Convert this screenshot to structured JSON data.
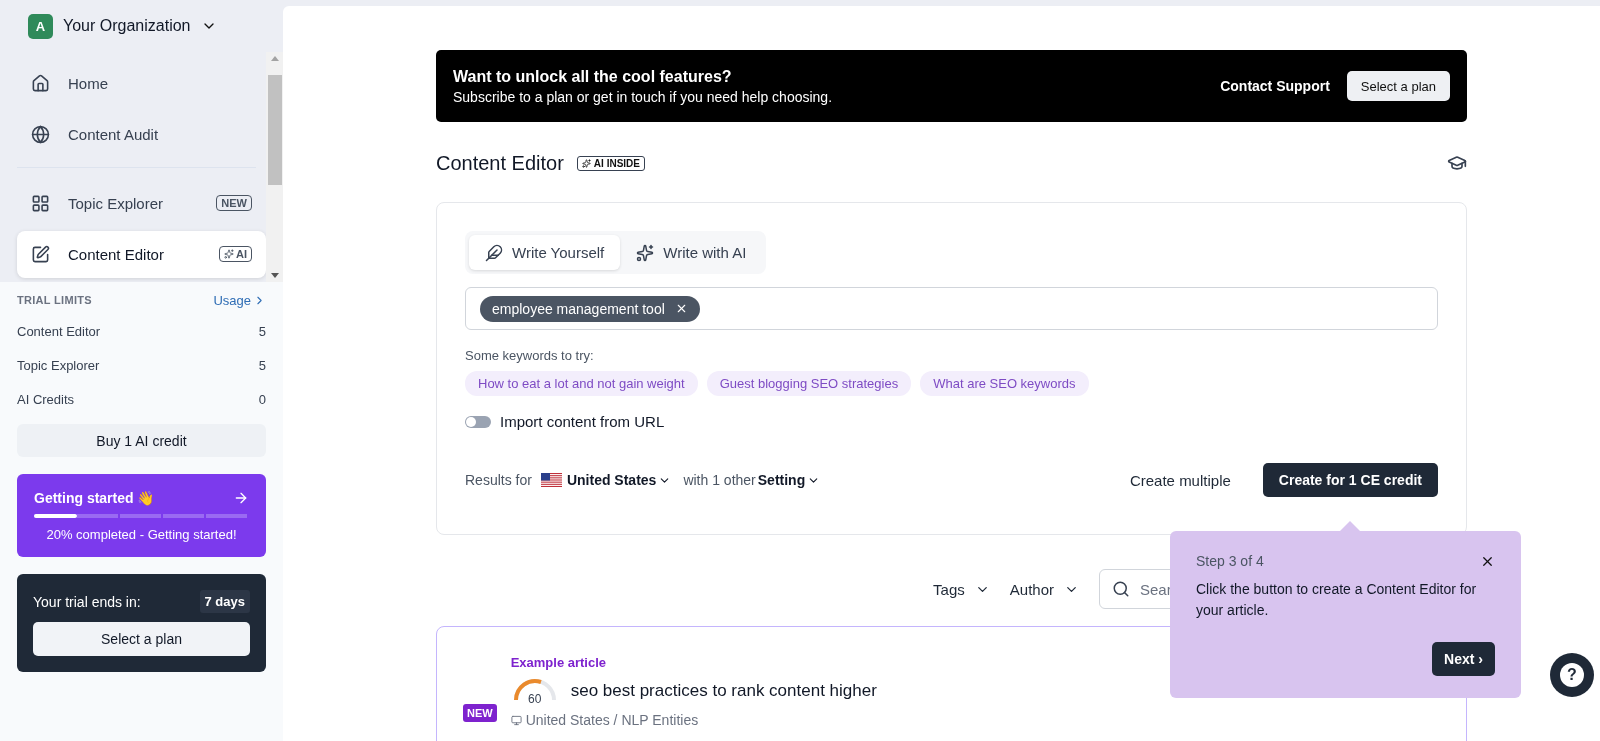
{
  "organization": {
    "initial": "A",
    "name": "Your Organization"
  },
  "sidebar": {
    "items": [
      {
        "label": "Home",
        "selected": false
      },
      {
        "label": "Content Audit",
        "selected": false
      },
      {
        "label": "Topic Explorer",
        "selected": false,
        "badge": "NEW"
      },
      {
        "label": "Content Editor",
        "selected": true,
        "badge": "AI"
      }
    ]
  },
  "trial_limits": {
    "title": "TRIAL LIMITS",
    "link": "Usage",
    "rows": [
      {
        "label": "Content Editor",
        "value": "5"
      },
      {
        "label": "Topic Explorer",
        "value": "5"
      },
      {
        "label": "AI Credits",
        "value": "0"
      }
    ],
    "button": "Buy 1 AI credit"
  },
  "getting_started": {
    "title": "Getting started",
    "emoji": "👋",
    "level": 0.2,
    "caption": "20% completed - Getting started!"
  },
  "trial": {
    "label": "Your trial ends in:",
    "days": "7 days",
    "button": "Select a plan"
  },
  "banner": {
    "title": "Want to unlock all the cool features?",
    "subtitle": "Subscribe to a plan or get in touch if you need help choosing.",
    "link": "Contact Support",
    "button": "Select a plan"
  },
  "header": {
    "title": "Content Editor",
    "badge": "AI INSIDE"
  },
  "tabs": [
    {
      "label": "Write Yourself",
      "selected": true
    },
    {
      "label": "Write with AI",
      "selected": false
    }
  ],
  "keyword_tags": [
    "employee management tool"
  ],
  "suggestions": {
    "label": "Some keywords to try:",
    "chips": [
      "How to eat a lot and not gain weight",
      "Guest blogging SEO strategies",
      "What are SEO keywords"
    ]
  },
  "import_toggle": {
    "label": "Import content from URL",
    "on": false
  },
  "results": {
    "prefix": "Results for",
    "country": "United States",
    "with": "with 1 other",
    "setting": "Setting"
  },
  "actions": {
    "secondary": "Create multiple",
    "primary": "Create for 1 CE credit"
  },
  "filters": {
    "tags": "Tags",
    "author": "Author",
    "search_placeholder": "Sear"
  },
  "article": {
    "label": "Example article",
    "badge": "NEW",
    "score": "60",
    "title": "seo best practices to rank content higher",
    "meta": "United States / NLP Entities"
  },
  "tooltip": {
    "step": "Step 3 of 4",
    "text": "Click the button to create a Content Editor for your article.",
    "button": "Next ›"
  },
  "help": {
    "label": "?"
  }
}
